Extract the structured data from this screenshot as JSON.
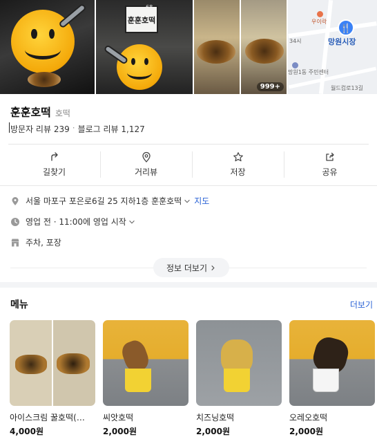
{
  "place": {
    "name": "훈훈호떡",
    "category": "호떡",
    "visitor_reviews": "방문자 리뷰 239",
    "blog_reviews": "블로그 리뷰 1,127"
  },
  "photos": {
    "count_badge": "999+",
    "sign_text": "훈훈호떡",
    "sign_number": "68"
  },
  "map": {
    "place_label": "망원시장",
    "labels": [
      "우이락",
      "망원1동 주민센터",
      "월드컵로13길",
      "34시"
    ]
  },
  "actions": [
    {
      "label": "길찾기",
      "icon": "directions-icon"
    },
    {
      "label": "거리뷰",
      "icon": "location-pin-icon"
    },
    {
      "label": "저장",
      "icon": "star-icon"
    },
    {
      "label": "공유",
      "icon": "share-icon"
    }
  ],
  "info": {
    "address": "서울 마포구 포은로6길 25 지하1층 훈훈호떡",
    "map_link": "지도",
    "hours": "영업 전 · 11:00에 영업 시작",
    "amenities": "주차, 포장",
    "more_info": "정보 더보기"
  },
  "menu": {
    "title": "메뉴",
    "more": "더보기",
    "items": [
      {
        "name": "아이스크림 꿀호떡(…",
        "price": "4,000원"
      },
      {
        "name": "씨앗호떡",
        "price": "2,000원"
      },
      {
        "name": "치즈닝호떡",
        "price": "2,000원"
      },
      {
        "name": "오레오호떡",
        "price": "2,000원"
      }
    ]
  },
  "colors": {
    "link": "#2b63d6",
    "map_pin": "#3b82f6"
  }
}
